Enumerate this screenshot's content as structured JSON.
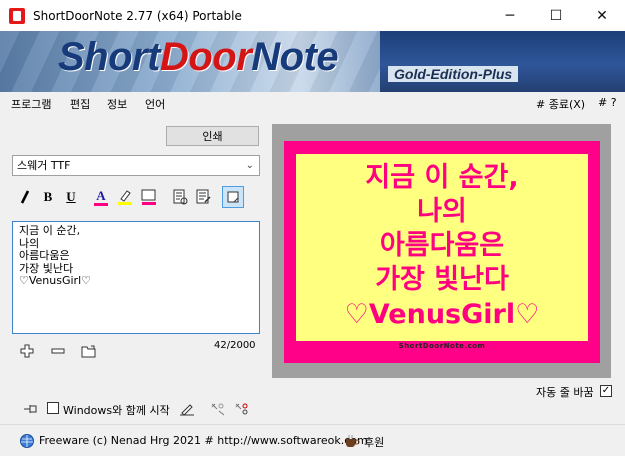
{
  "window": {
    "title": "ShortDoorNote 2.77  (x64) Portable",
    "minimize": "─",
    "maximize": "☐",
    "close": "✕"
  },
  "banner": {
    "title_part1": "Short",
    "title_part2": "Door",
    "title_part3": "Note",
    "subtitle": "Gold-Edition-Plus"
  },
  "menu": {
    "items": [
      "프로그램",
      "편집",
      "정보",
      "언어"
    ],
    "exit": "# 종료(X)",
    "help": "# ?"
  },
  "print_label": "인쇄",
  "font_select": {
    "value": "스웨거 TTF"
  },
  "toolbar": {
    "italic_glyph": "I",
    "bold": "B",
    "underline": "U",
    "font_color": "A"
  },
  "note": {
    "text": "지금 이 순간,\n나의\n아름다움은\n가장 빛난다\n♡VenusGirl♡"
  },
  "counter": "42/2000",
  "preview": {
    "lines": [
      "지금 이 순간,",
      "나의",
      "아름다움은",
      "가장 빛난다",
      "♡VenusGirl♡"
    ],
    "credit": "ShortDoorNote.com",
    "colors": {
      "text": "#ff0080",
      "background": "#ffff80",
      "border": "#ff0088",
      "frame": "#a0a0a0"
    }
  },
  "word_wrap": {
    "label": "자동 줄 바꿈",
    "checked": "✓"
  },
  "autostart": {
    "label": "Windows와 함께 시작"
  },
  "footer": {
    "text": "Freeware (c) Nenad Hrg 2021 # http://www.softwareok.com",
    "donate": "후원"
  }
}
